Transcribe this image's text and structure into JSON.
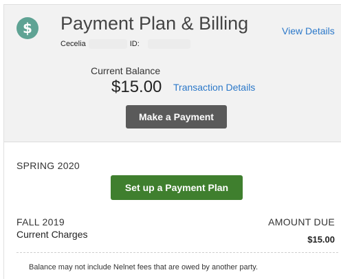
{
  "header": {
    "icon": "dollar-icon",
    "icon_glyph": "$",
    "icon_color": "#5fa394",
    "title": "Payment Plan & Billing",
    "view_details_label": "View Details",
    "student_first_name": "Cecelia",
    "id_label": "ID:"
  },
  "balance": {
    "label": "Current Balance",
    "amount": "$15.00",
    "transaction_details_label": "Transaction Details",
    "make_payment_label": "Make a Payment"
  },
  "terms": [
    {
      "name": "SPRING 2020",
      "action_label": "Set up a Payment Plan"
    },
    {
      "name": "FALL 2019",
      "amount_due_header": "AMOUNT DUE",
      "charges_label": "Current Charges",
      "charges_amount": "$15.00"
    }
  ],
  "disclaimer": "Balance may not include Nelnet fees that are owed by another party.",
  "colors": {
    "link": "#2b78c9",
    "pay_button": "#5a5a5a",
    "plan_button": "#3f7f2e",
    "header_bg": "#f2f2f2"
  }
}
